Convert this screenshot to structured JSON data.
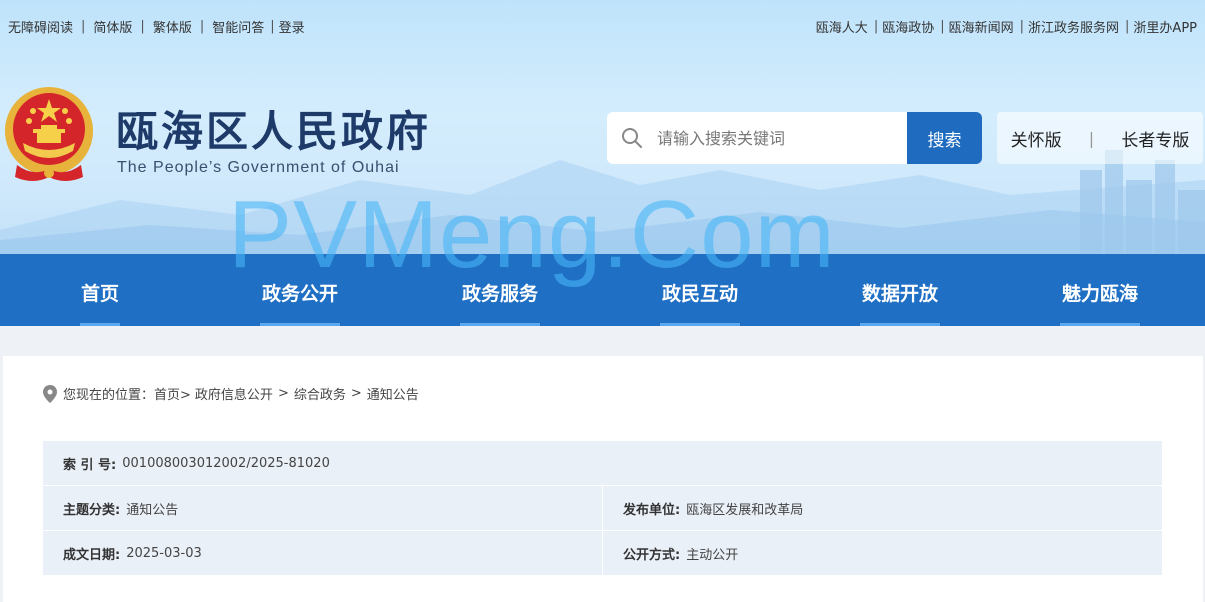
{
  "topbar": {
    "left": [
      "无障碍阅读",
      "简体版",
      "繁体版",
      "智能问答",
      "登录"
    ],
    "right": [
      "瓯海人大",
      "瓯海政协",
      "瓯海新闻网",
      "浙江政务服务网",
      "浙里办APP"
    ]
  },
  "site": {
    "title": "瓯海区人民政府",
    "subtitle": "The People’s Government of Ouhai"
  },
  "search": {
    "placeholder": "请输入搜索关键词",
    "button": "搜索"
  },
  "modes": {
    "care": "关怀版",
    "separator": "|",
    "elder": "长者专版"
  },
  "watermark": "PVMeng.Com",
  "nav": [
    "首页",
    "政务公开",
    "政务服务",
    "政民互动",
    "数据开放",
    "魅力瓯海"
  ],
  "breadcrumb": {
    "prefix": "您现在的位置：",
    "items": [
      "首页>",
      "政府信息公开",
      ">",
      "综合政务",
      ">",
      "通知公告"
    ]
  },
  "info": {
    "index_label": "索 引 号:",
    "index_value": "001008003012002/2025-81020",
    "category_label": "主题分类:",
    "category_value": "通知公告",
    "publisher_label": "发布单位:",
    "publisher_value": "瓯海区发展和改革局",
    "date_label": "成文日期:",
    "date_value": "2025-03-03",
    "disclosure_label": "公开方式:",
    "disclosure_value": "主动公开"
  },
  "colors": {
    "nav_bg": "#1f6fc4",
    "search_btn": "#1f6bc0",
    "title": "#1d3a69",
    "info_bg": "#eaf0f8"
  }
}
